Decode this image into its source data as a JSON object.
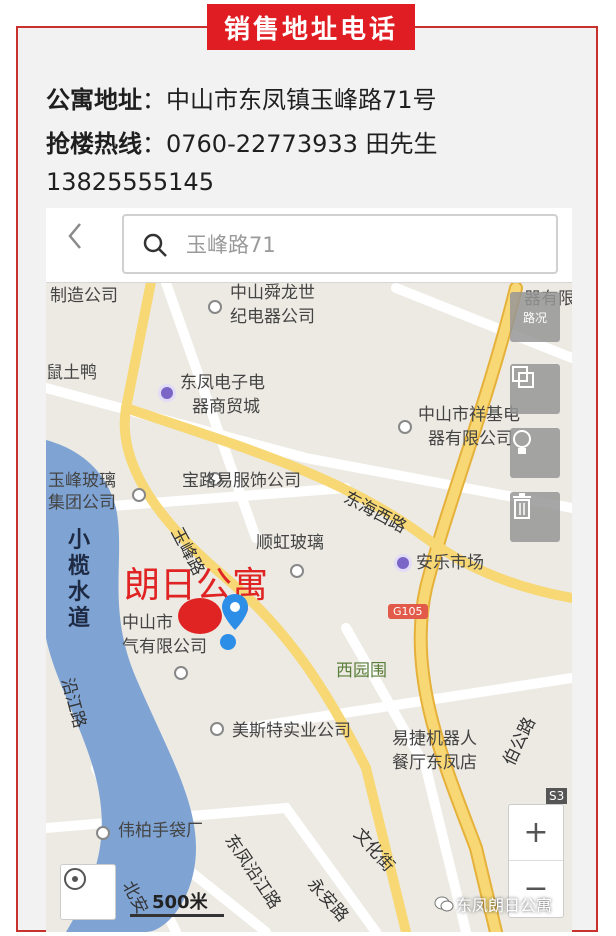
{
  "header": {
    "title": "销售地址电话"
  },
  "info": {
    "address_label": "公寓地址",
    "address_value": "：中山市东凤镇玉峰路71号",
    "hotline_label": "抢楼热线",
    "hotline_value": "：0760-22773933   田先生",
    "mobile": "13825555145"
  },
  "map": {
    "search": {
      "placeholder": "玉峰路71"
    },
    "poi_labels": [
      "制造公司",
      "中山舜龙世",
      "纪电器公司",
      "器有限",
      "东凤电子电",
      "器商贸城",
      "中山市祥基电",
      "器有限公司",
      "玉峰玻璃",
      "集团公司",
      "宝路易服饰公司",
      "顺虹玻璃",
      "安乐市场",
      "中山市",
      "气有限公司",
      "西园围",
      "美斯特实业公司",
      "易捷机器人",
      "餐厅东凤店",
      "伟柏手袋厂",
      "鼠土鸭"
    ],
    "road_labels": [
      "东海西路",
      "玉峰路",
      "沿江路",
      "东凤沿江路",
      "伯公路",
      "文化街",
      "永安路",
      "G105",
      "S3",
      "北安"
    ],
    "river_label": "小榄水道",
    "marker_label": "朗日公寓",
    "side_buttons": [
      "路况",
      "图层",
      "地点",
      "清除"
    ],
    "scale_label": "500米",
    "zoom_in": "+",
    "zoom_out": "−"
  },
  "watermark": "东凤朗日公寓",
  "colors": {
    "accent_red": "#e01d23",
    "border_red": "#c9312d",
    "river": "#7fa4d4",
    "major_road": "#f2c94c"
  }
}
